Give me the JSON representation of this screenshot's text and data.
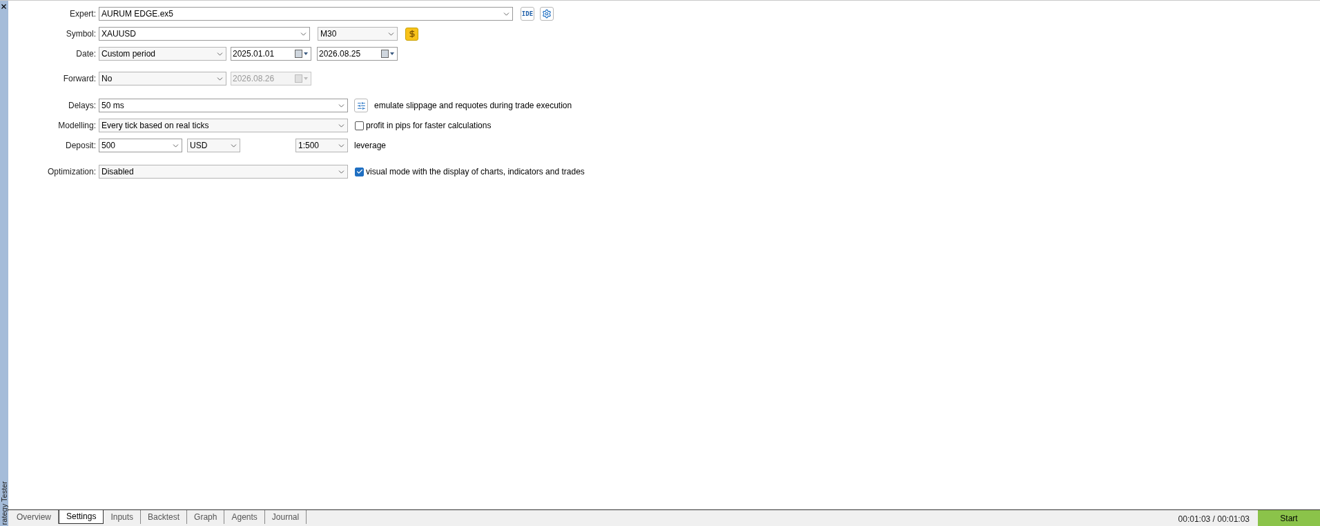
{
  "side_panel": {
    "title": "rategy Tester"
  },
  "expert": {
    "label": "Expert:",
    "value": "AURUM EDGE.ex5",
    "ide_button": "IDE"
  },
  "symbol": {
    "label": "Symbol:",
    "value": "XAUUSD",
    "timeframe": "M30"
  },
  "date": {
    "label": "Date:",
    "value": "Custom period",
    "from": "2025.01.01",
    "to": "2026.08.25"
  },
  "forward": {
    "label": "Forward:",
    "value": "No",
    "date": "2026.08.26",
    "date_disabled": true
  },
  "delays": {
    "label": "Delays:",
    "value": "50 ms",
    "note": "emulate slippage and requotes during trade execution"
  },
  "modelling": {
    "label": "Modelling:",
    "value": "Every tick based on real ticks",
    "option": {
      "label": "profit in pips for faster calculations",
      "checked": false
    }
  },
  "deposit": {
    "label": "Deposit:",
    "value": "500",
    "currency": "USD",
    "leverage": "1:500",
    "leverage_label": "leverage"
  },
  "optimization": {
    "label": "Optimization:",
    "value": "Disabled",
    "option": {
      "label": "visual mode with the display of charts, indicators and trades",
      "checked": true
    }
  },
  "tabs": [
    {
      "label": "Overview",
      "selected": false
    },
    {
      "label": "Settings",
      "selected": true
    },
    {
      "label": "Inputs",
      "selected": false
    },
    {
      "label": "Backtest",
      "selected": false
    },
    {
      "label": "Graph",
      "selected": false
    },
    {
      "label": "Agents",
      "selected": false
    },
    {
      "label": "Journal",
      "selected": false
    }
  ],
  "status": {
    "time": "00:01:03 / 00:01:03",
    "start_button": "Start"
  }
}
